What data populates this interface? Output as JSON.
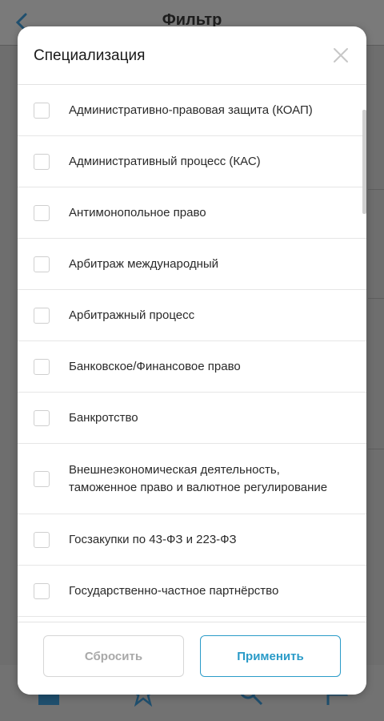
{
  "background": {
    "title": "Фильтр"
  },
  "modal": {
    "title": "Специализация",
    "items": [
      {
        "label": "Административно-правовая защита (КОАП)"
      },
      {
        "label": "Административный процесс (КАС)"
      },
      {
        "label": "Антимонопольное право"
      },
      {
        "label": "Арбитраж международный"
      },
      {
        "label": "Арбитражный процесс"
      },
      {
        "label": "Банковское/Финансовое право"
      },
      {
        "label": "Банкротство"
      },
      {
        "label": "Внешнеэкономическая деятельность, таможенное право и валютное регулирование"
      },
      {
        "label": "Госзакупки по 43-ФЗ и 223-ФЗ"
      },
      {
        "label": "Государственно-частное партнёрство"
      }
    ],
    "buttons": {
      "reset": "Сбросить",
      "apply": "Применить"
    }
  },
  "colors": {
    "accent": "#2a9bc8",
    "disabled_text": "#a9a9a9"
  }
}
